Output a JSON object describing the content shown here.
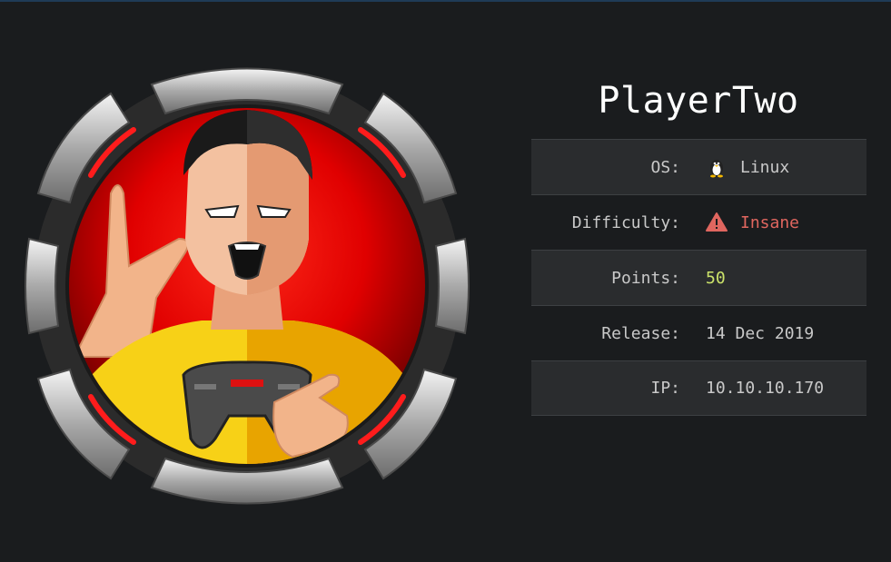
{
  "machine": {
    "name": "PlayerTwo",
    "avatar_icon": "gamer-with-controller-badge"
  },
  "info": [
    {
      "label": "OS:",
      "value": "Linux",
      "icon": "linux-penguin-icon"
    },
    {
      "label": "Difficulty:",
      "value": "Insane",
      "icon": "warning-icon",
      "color": "#e0665f"
    },
    {
      "label": "Points:",
      "value": "50",
      "color": "#cbe36a"
    },
    {
      "label": "Release:",
      "value": "14 Dec 2019"
    },
    {
      "label": "IP:",
      "value": "10.10.10.170"
    }
  ],
  "colors": {
    "background": "#1a1c1e",
    "row_shade": "#2a2c2e",
    "insane": "#e0665f",
    "points": "#cbe36a"
  }
}
